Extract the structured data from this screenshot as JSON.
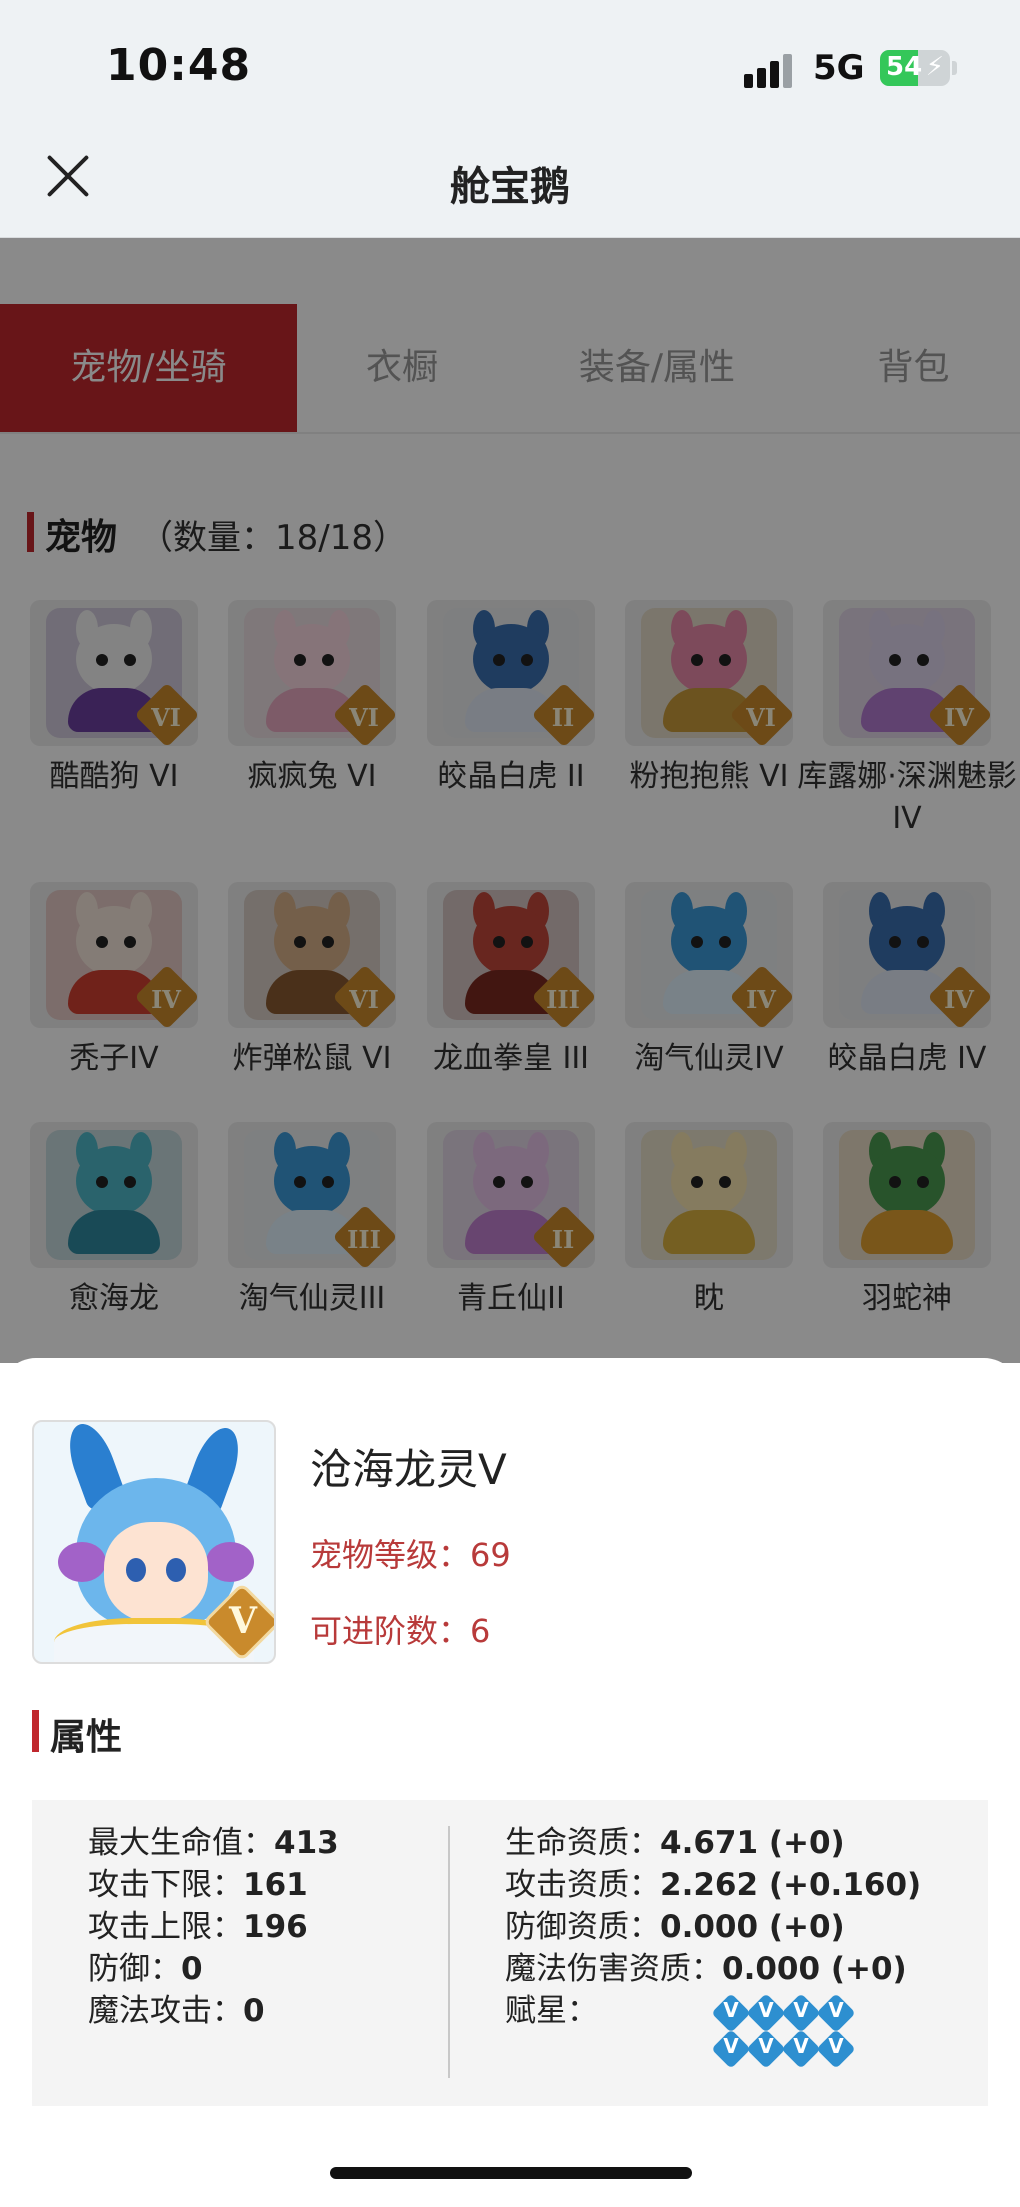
{
  "status_bar": {
    "time": "10:48",
    "network": "5G",
    "battery_pct": "54",
    "battery_level": 0.54
  },
  "nav": {
    "title": "舱宝鹅"
  },
  "tabs": [
    {
      "label": "宠物/坐骑",
      "active": true
    },
    {
      "label": "衣橱",
      "active": false
    },
    {
      "label": "装备/属性",
      "active": false
    },
    {
      "label": "背包",
      "active": false
    }
  ],
  "pet_section": {
    "title": "宠物",
    "count": "（数量：18/18）"
  },
  "pets": [
    {
      "name": "酷酷狗 VI",
      "rank": "VI",
      "color": "#f2f2f2",
      "accent": "#6b3fa0"
    },
    {
      "name": "疯疯兔 VI",
      "rank": "VI",
      "color": "#f8d7df",
      "accent": "#e7a9c0"
    },
    {
      "name": "皎晶白虎 II",
      "rank": "II",
      "color": "#3a6fb0",
      "accent": "#dfe8f4"
    },
    {
      "name": "粉抱抱熊 VI",
      "rank": "VI",
      "color": "#e78aa8",
      "accent": "#c79a3a"
    },
    {
      "name": "库露娜·深渊魅影IV",
      "rank": "IV",
      "color": "#dcd2ea",
      "accent": "#b27ad0"
    },
    {
      "name": "秃子IV",
      "rank": "IV",
      "color": "#f4e6da",
      "accent": "#d04030"
    },
    {
      "name": "炸弹松鼠 VI",
      "rank": "VI",
      "color": "#d7b08a",
      "accent": "#8a5a30"
    },
    {
      "name": "龙血拳皇 III",
      "rank": "III",
      "color": "#c0463a",
      "accent": "#7a2a20"
    },
    {
      "name": "淘气仙灵IV",
      "rank": "IV",
      "color": "#3b9ad8",
      "accent": "#dff0fb"
    },
    {
      "name": "皎晶白虎 IV",
      "rank": "IV",
      "color": "#3a6fb0",
      "accent": "#dfe8f4"
    },
    {
      "name": "愈海龙",
      "rank": "",
      "color": "#4fb8c8",
      "accent": "#2f8aa0"
    },
    {
      "name": "淘气仙灵III",
      "rank": "III",
      "color": "#3b9ad8",
      "accent": "#dff0fb"
    },
    {
      "name": "青丘仙II",
      "rank": "II",
      "color": "#e6c2e8",
      "accent": "#c080d0"
    },
    {
      "name": "眈",
      "rank": "",
      "color": "#f5e3b0",
      "accent": "#d8b040"
    },
    {
      "name": "羽蛇神",
      "rank": "",
      "color": "#4a9a50",
      "accent": "#e0a030"
    }
  ],
  "detail": {
    "name": "沧海龙灵V",
    "rank": "V",
    "level_label": "宠物等级：69",
    "advance_label": "可进阶数：6",
    "attr_title": "属性",
    "left_attrs": [
      {
        "label": "最大生命值：",
        "value": "413"
      },
      {
        "label": "攻击下限：",
        "value": "161"
      },
      {
        "label": "攻击上限：",
        "value": "196"
      },
      {
        "label": "防御：",
        "value": "0"
      },
      {
        "label": "魔法攻击：",
        "value": "0"
      }
    ],
    "right_attrs": [
      {
        "label": "生命资质：",
        "value": "4.671 (+0)"
      },
      {
        "label": "攻击资质：",
        "value": "2.262 (+0.160)"
      },
      {
        "label": "防御资质：",
        "value": "0.000 (+0)"
      },
      {
        "label": "魔法伤害资质：",
        "value": "0.000 (+0)"
      }
    ],
    "star_label": "赋星：",
    "star_count": 8,
    "star_glyph": "V",
    "star_color": "#2d8fd0",
    "accent_color": "#c0282e"
  }
}
